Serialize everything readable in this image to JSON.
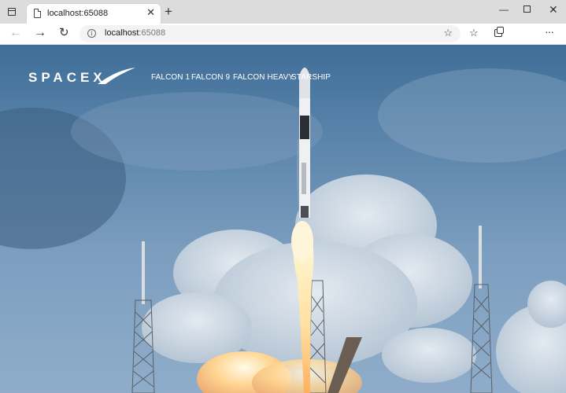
{
  "browser": {
    "tab_title": "localhost:65088",
    "tab_close": "✕",
    "new_tab": "+",
    "url_host": "localhost",
    "url_port": ":65088",
    "window_controls": {
      "minimize": "—",
      "close": "✕"
    },
    "nav": {
      "back": "←",
      "forward": "→",
      "reload": "↻"
    },
    "info_glyph": "i",
    "favorites_glyph": "☆",
    "fav_add_glyph": "☆",
    "menu_glyph": "···"
  },
  "site": {
    "logo_text": "SPACEX",
    "nav_links": [
      "FALCON 1",
      "FALCON 9",
      "FALCON HEAVY",
      "STARSHIP"
    ]
  },
  "icons": {
    "tab_switch": "tab-actions-icon",
    "page": "page-icon",
    "info": "info-icon",
    "favorites": "favorites-icon",
    "collections": "collections-icon",
    "menu": "more-menu-icon"
  },
  "colors": {
    "sky": "#5e87ad",
    "nav_text": "#ffffff",
    "tabbar": "#dcdcdc"
  }
}
